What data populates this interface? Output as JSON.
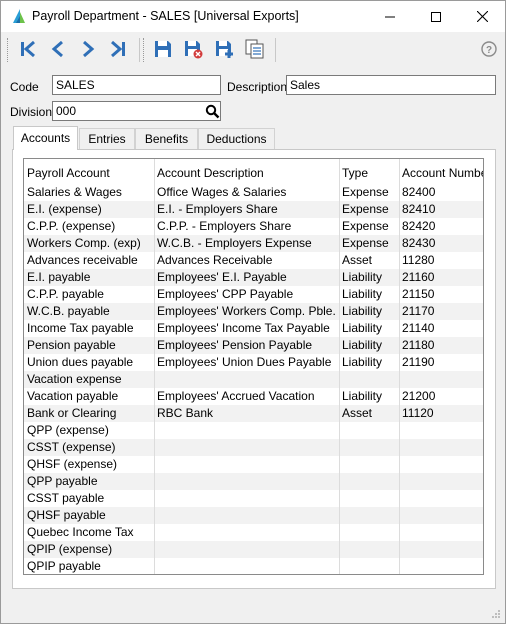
{
  "window": {
    "title": "Payroll Department - SALES [Universal Exports]"
  },
  "form": {
    "code_label": "Code",
    "code_value": "SALES",
    "description_label": "Description",
    "description_value": "Sales",
    "division_label": "Division",
    "division_value": "000"
  },
  "tabs": [
    {
      "label": "Accounts"
    },
    {
      "label": "Entries"
    },
    {
      "label": "Benefits"
    },
    {
      "label": "Deductions"
    }
  ],
  "grid": {
    "columns": [
      "Payroll Account",
      "Account Description",
      "Type",
      "Account Number"
    ],
    "rows": [
      [
        "Salaries & Wages",
        "Office Wages & Salaries",
        "Expense",
        "82400"
      ],
      [
        "E.I. (expense)",
        "E.I. - Employers Share",
        "Expense",
        "82410"
      ],
      [
        "C.P.P. (expense)",
        "C.P.P. - Employers Share",
        "Expense",
        "82420"
      ],
      [
        "Workers Comp. (exp)",
        "W.C.B. - Employers Expense",
        "Expense",
        "82430"
      ],
      [
        "Advances receivable",
        "Advances Receivable",
        "Asset",
        "11280"
      ],
      [
        "E.I. payable",
        "Employees' E.I. Payable",
        "Liability",
        "21160"
      ],
      [
        "C.P.P. payable",
        "Employees' CPP Payable",
        "Liability",
        "21150"
      ],
      [
        "W.C.B. payable",
        "Employees' Workers Comp. Pble.",
        "Liability",
        "21170"
      ],
      [
        "Income Tax payable",
        "Employees' Income Tax Payable",
        "Liability",
        "21140"
      ],
      [
        "Pension payable",
        "Employees' Pension Payable",
        "Liability",
        "21180"
      ],
      [
        "Union dues payable",
        "Employees' Union Dues Payable",
        "Liability",
        "21190"
      ],
      [
        "Vacation expense",
        "",
        "",
        ""
      ],
      [
        "Vacation payable",
        "Employees' Accrued Vacation",
        "Liability",
        "21200"
      ],
      [
        "Bank or Clearing",
        "RBC Bank",
        "Asset",
        "11120"
      ],
      [
        "QPP (expense)",
        "",
        "",
        ""
      ],
      [
        "CSST (expense)",
        "",
        "",
        ""
      ],
      [
        "QHSF (expense)",
        "",
        "",
        ""
      ],
      [
        "QPP payable",
        "",
        "",
        ""
      ],
      [
        "CSST payable",
        "",
        "",
        ""
      ],
      [
        "QHSF payable",
        "",
        "",
        ""
      ],
      [
        "Quebec Income Tax",
        "",
        "",
        ""
      ],
      [
        "QPIP (expense)",
        "",
        "",
        ""
      ],
      [
        "QPIP payable",
        "",
        "",
        ""
      ]
    ]
  },
  "colors": {
    "toolbar_icon": "#2f6fb7",
    "delete_accent": "#d23c3c",
    "add_accent": "#2f6fb7"
  }
}
